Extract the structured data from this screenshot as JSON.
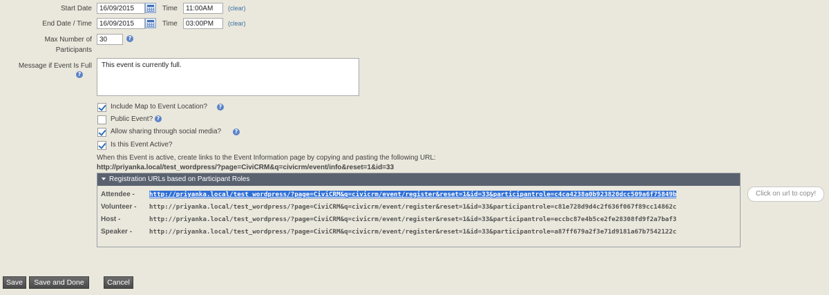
{
  "start": {
    "label": "Start Date",
    "date": "16/09/2015",
    "time_label": "Time",
    "time": "11:00AM",
    "clear": "(clear)"
  },
  "end": {
    "label": "End Date / Time",
    "date": "16/09/2015",
    "time_label": "Time",
    "time": "03:00PM",
    "clear": "(clear)"
  },
  "max": {
    "label_line1": "Max Number of",
    "label_line2": "Participants",
    "value": "30"
  },
  "full_message": {
    "label": "Message if Event Is Full",
    "value": "This event is currently full."
  },
  "help_glyph": "?",
  "checkboxes": [
    {
      "label": "Include Map to Event Location?",
      "checked": true,
      "help": true
    },
    {
      "label": "Public Event?",
      "checked": false,
      "help": true
    },
    {
      "label": "Allow sharing through social media?",
      "checked": true,
      "help": true
    },
    {
      "label": "Is this Event Active?",
      "checked": true,
      "help": false
    }
  ],
  "info": {
    "text": "When this Event is active, create links to the Event Information page by copying and pasting the following URL:",
    "url": "http://priyanka.local/test_wordpress/?page=CiviCRM&q=civicrm/event/info&reset=1&id=33"
  },
  "registration": {
    "title": "Registration URLs based on Participant Roles",
    "rows": [
      {
        "role": "Attendee -",
        "url": "http://priyanka.local/test_wordpress/?page=CiviCRM&q=civicrm/event/register&reset=1&id=33&participantrole=c4ca4238a0b923820dcc509a6f75849b",
        "selected": true
      },
      {
        "role": "Volunteer -",
        "url": "http://priyanka.local/test_wordpress/?page=CiviCRM&q=civicrm/event/register&reset=1&id=33&participantrole=c81e728d9d4c2f636f067f89cc14862c",
        "selected": false
      },
      {
        "role": "Host -",
        "url": "http://priyanka.local/test_wordpress/?page=CiviCRM&q=civicrm/event/register&reset=1&id=33&participantrole=eccbc87e4b5ce2fe28308fd9f2a7baf3",
        "selected": false
      },
      {
        "role": "Speaker -",
        "url": "http://priyanka.local/test_wordpress/?page=CiviCRM&q=civicrm/event/register&reset=1&id=33&participantrole=a87ff679a2f3e71d9181a67b7542122c",
        "selected": false
      }
    ]
  },
  "tooltip": "Click on url to copy!",
  "buttons": {
    "save": "Save",
    "save_done": "Save and Done",
    "cancel": "Cancel"
  }
}
